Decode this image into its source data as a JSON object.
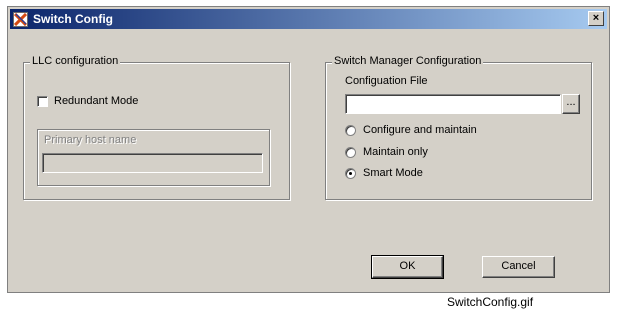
{
  "window": {
    "title": "Switch Config",
    "close_glyph": "×",
    "icon": "app-x-icon"
  },
  "llc": {
    "legend": "LLC configuration",
    "redundant_label": "Redundant Mode",
    "redundant_checked": false,
    "primary_host_legend": "Primary host name",
    "primary_host_value": ""
  },
  "switch_manager": {
    "legend": "Switch Manager Configuration",
    "config_file_label": "Configuation File",
    "config_file_value": "",
    "browse_label": "...",
    "options": [
      {
        "label": "Configure and maintain",
        "selected": false
      },
      {
        "label": "Maintain only",
        "selected": false
      },
      {
        "label": "Smart Mode",
        "selected": true
      }
    ]
  },
  "buttons": {
    "ok": "OK",
    "cancel": "Cancel"
  },
  "caption": "SwitchConfig.gif"
}
